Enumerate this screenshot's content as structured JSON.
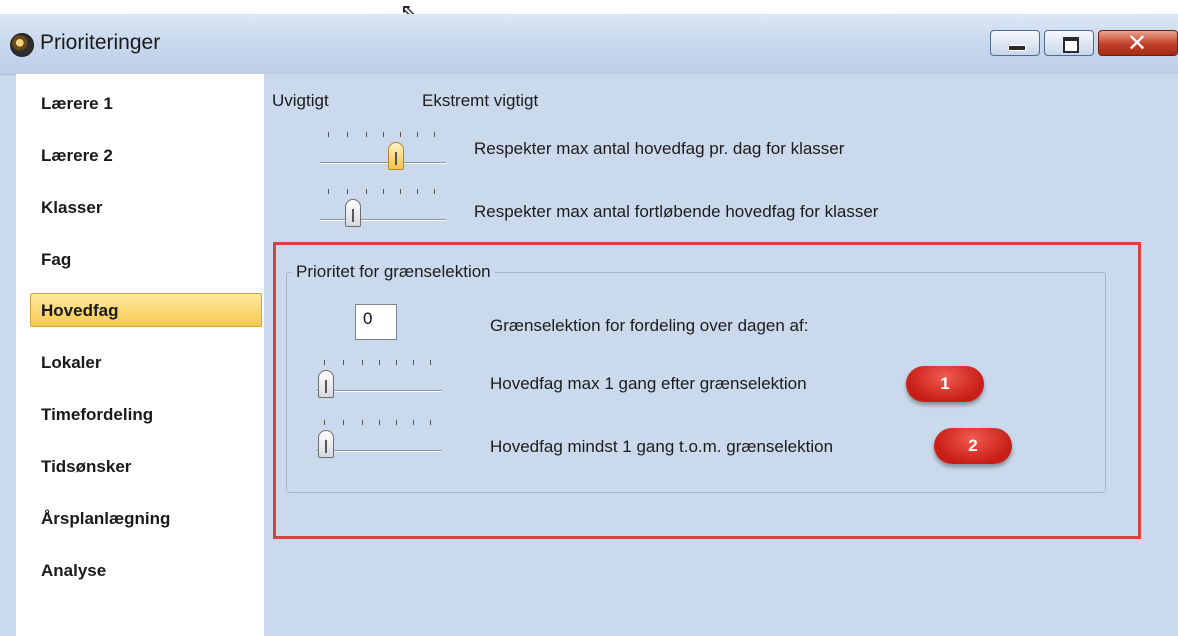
{
  "window": {
    "title": "Prioriteringer"
  },
  "sidebar": {
    "items": [
      {
        "label": "Lærere 1",
        "selected": false
      },
      {
        "label": "Lærere 2",
        "selected": false
      },
      {
        "label": "Klasser",
        "selected": false
      },
      {
        "label": "Fag",
        "selected": false
      },
      {
        "label": "Hovedfag",
        "selected": true
      },
      {
        "label": "Lokaler",
        "selected": false
      },
      {
        "label": "Timefordeling",
        "selected": false
      },
      {
        "label": "Tidsønsker",
        "selected": false
      },
      {
        "label": "Årsplanlægning",
        "selected": false
      },
      {
        "label": "Analyse",
        "selected": false
      }
    ]
  },
  "main": {
    "scale_low": "Uvigtigt",
    "scale_high": "Ekstremt vigtigt",
    "priorities": [
      {
        "label": "Respekter max antal hovedfag pr. dag for klasser",
        "level": 0.5
      },
      {
        "label": "Respekter max antal fortløbende hovedfag for klasser",
        "level": 0.17
      }
    ],
    "group": {
      "title": "Prioritet for grænselektion",
      "threshold_value": "0",
      "threshold_label": "Grænselektion for fordeling over dagen af:",
      "rows": [
        {
          "label": "Hovedfag max 1 gang efter grænselektion",
          "level": 0.0,
          "badge": "1"
        },
        {
          "label": "Hovedfag mindst 1 gang t.o.m. grænselektion",
          "level": 0.0,
          "badge": "2"
        }
      ]
    }
  },
  "colors": {
    "accent_selected": "#f8c94f",
    "highlight_box": "#d9413a",
    "badge": "#c71e16",
    "panel_bg": "#cad9ec"
  }
}
